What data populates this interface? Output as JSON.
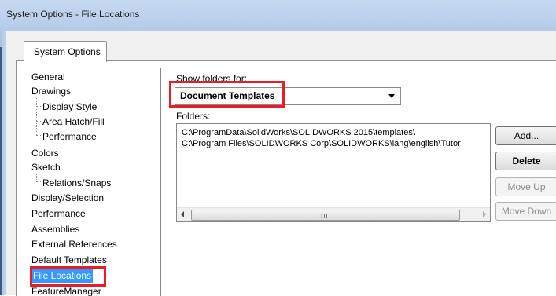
{
  "window": {
    "title": "System Options - File Locations"
  },
  "tab": {
    "label": "System Options"
  },
  "tree": {
    "items": [
      "General",
      "Drawings",
      "Display Style",
      "Area Hatch/Fill",
      "Performance",
      "Colors",
      "Sketch",
      "Relations/Snaps",
      "Display/Selection",
      "Performance",
      "Assemblies",
      "External References",
      "Default Templates",
      "File Locations",
      "FeatureManager"
    ],
    "selected": "File Locations"
  },
  "show_folders": {
    "label": "Show folders for:",
    "value": "Document Templates"
  },
  "folders": {
    "label": "Folders:",
    "rows": [
      "C:\\ProgramData\\SolidWorks\\SOLIDWORKS 2015\\templates\\",
      "C:\\Program Files\\SOLIDWORKS Corp\\SOLIDWORKS\\lang\\english\\Tutor"
    ],
    "scroll_grip": "III"
  },
  "buttons": {
    "add": "Add...",
    "delete": "Delete",
    "move_up": "Move Up",
    "move_down": "Move Down"
  },
  "colors": {
    "highlight": "#ea1c24",
    "selection": "#3399ff"
  }
}
